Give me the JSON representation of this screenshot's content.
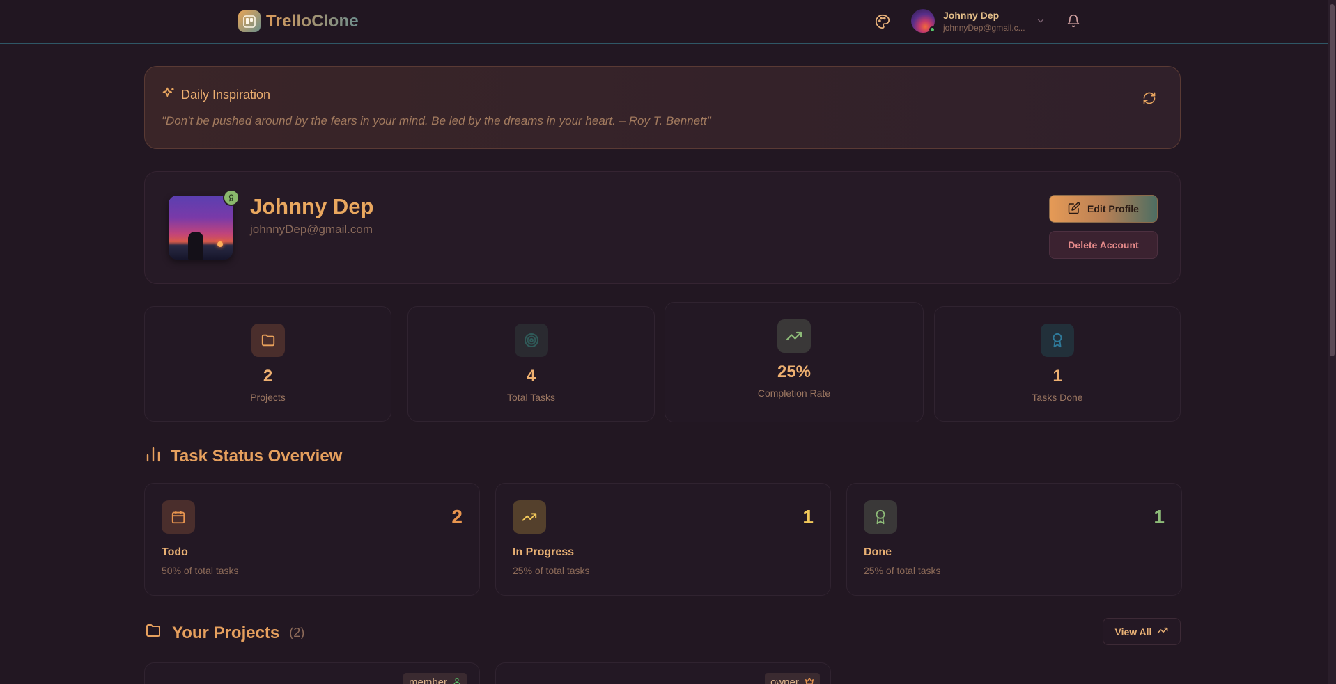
{
  "brand": {
    "name": "TrelloClone"
  },
  "user": {
    "name": "Johnny Dep",
    "email": "johnnyDep@gmail.com",
    "email_truncated": "johnnyDep@gmail.c..."
  },
  "inspiration": {
    "title": "Daily Inspiration",
    "quote": "\"Don't be pushed around by the fears in your mind. Be led by the dreams in your heart. – Roy T. Bennett\""
  },
  "profile": {
    "name": "Johnny Dep",
    "email": "johnnyDep@gmail.com",
    "edit_label": "Edit Profile",
    "delete_label": "Delete Account"
  },
  "stats": [
    {
      "value": "2",
      "label": "Projects"
    },
    {
      "value": "4",
      "label": "Total Tasks"
    },
    {
      "value": "25%",
      "label": "Completion Rate"
    },
    {
      "value": "1",
      "label": "Tasks Done"
    }
  ],
  "task_overview": {
    "title": "Task Status Overview",
    "cards": [
      {
        "name": "Todo",
        "count": "2",
        "sub": "50% of total tasks",
        "color": "#e8954f"
      },
      {
        "name": "In Progress",
        "count": "1",
        "sub": "25% of total tasks",
        "color": "#f0c75a"
      },
      {
        "name": "Done",
        "count": "1",
        "sub": "25% of total tasks",
        "color": "#8dbb78"
      }
    ]
  },
  "projects": {
    "title": "Your Projects",
    "count": "(2)",
    "view_all": "View All",
    "items": [
      {
        "role": "member"
      },
      {
        "role": "owner"
      }
    ]
  },
  "colors": {
    "accent": "#e6a05e",
    "background": "#221722",
    "card": "#231824"
  }
}
